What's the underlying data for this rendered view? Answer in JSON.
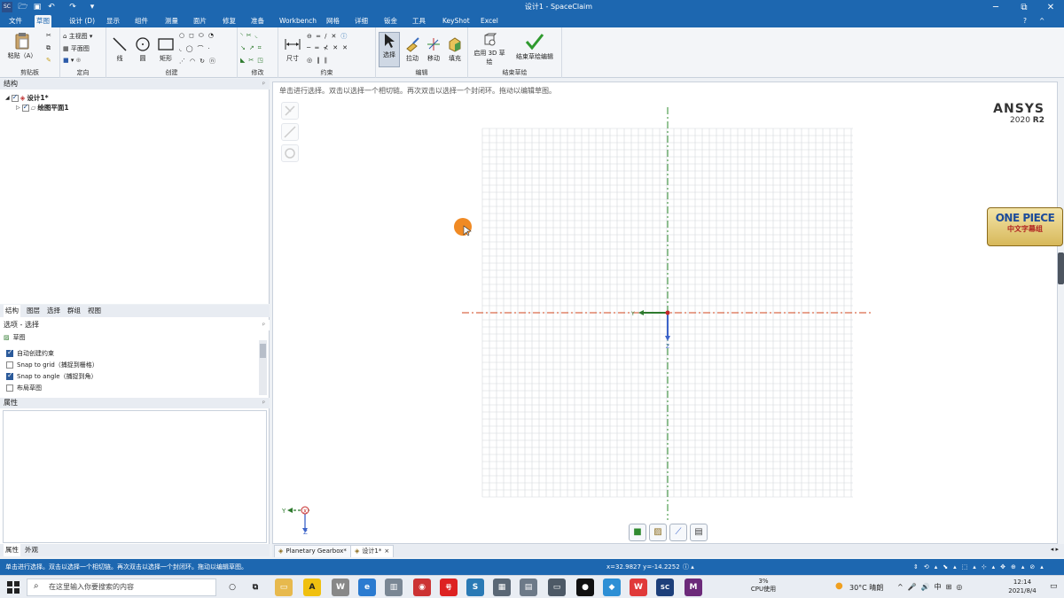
{
  "titlebar": {
    "title": "设计1 - SpaceClaim",
    "app_badge": "SC",
    "min": "─",
    "max": "⧉",
    "close": "✕"
  },
  "menu": {
    "tabs": [
      "文件",
      "草图",
      "设计 (D)",
      "显示",
      "组件",
      "测量",
      "面片",
      "修复",
      "准备",
      "Workbench",
      "网格",
      "详细",
      "钣金",
      "工具",
      "KeyShot",
      "Excel"
    ]
  },
  "ribbon": {
    "clipboard": {
      "paste": "粘贴（A）",
      "group": "剪贴板"
    },
    "orient": {
      "home": "主视图",
      "plane": "平面图",
      "group": "定向"
    },
    "create": {
      "line": "线",
      "circle": "圆",
      "rect": "矩形",
      "group": "创建"
    },
    "modify": {
      "group": "修改"
    },
    "constraint": {
      "dimension": "尺寸",
      "group": "约束"
    },
    "edit": {
      "select": "选择",
      "pull": "拉动",
      "move": "移动",
      "fill": "填充",
      "group": "编辑"
    },
    "finish": {
      "enable3d": "启用 3D 草绘",
      "finish": "结束草绘编辑",
      "group": "结束草绘"
    }
  },
  "structure": {
    "header": "结构",
    "root": "设计1*",
    "child": "绘图平面1"
  },
  "panel_tabs": [
    "结构",
    "图层",
    "选择",
    "群组",
    "视图"
  ],
  "options": {
    "header": "选项 - 选择",
    "section": "草图",
    "items": [
      {
        "label": "自动创建约束",
        "checked": true
      },
      {
        "label": "Snap to grid（捕捉到栅格）",
        "checked": false
      },
      {
        "label": "Snap to angle（捕捉到角）",
        "checked": true
      },
      {
        "label": "布局草图",
        "checked": false
      }
    ]
  },
  "properties": {
    "header": "属性"
  },
  "bottom_tabs": [
    "属性",
    "外观"
  ],
  "canvas": {
    "hint": "单击进行选择。双击以选择一个相切链。再次双击以选择一个封闭环。拖动以编辑草图。",
    "ansys": "ANSYS",
    "release_year": "2020",
    "release_tag": "R2",
    "badge_text": "ONE PIECE",
    "badge_sub": "中文字幕组",
    "axis_y": "Y",
    "axis_z": "Z",
    "axis_x": "X"
  },
  "docs": {
    "tabs": [
      {
        "label": "Planetary Gearbox*",
        "active": false
      },
      {
        "label": "设计1*",
        "active": true
      }
    ],
    "close": "×"
  },
  "status": {
    "text": "单击进行选择。双击以选择一个相切链。再次双击以选择一个封闭环。拖动以编辑草图。",
    "coords": "x=32.9827  y=-14.2252"
  },
  "taskbar": {
    "search_placeholder": "在这里输入你要搜索的内容",
    "cpu_percent": "3%",
    "cpu_label": "CPU使用",
    "weather": "30°C 晴朗",
    "time": "12:14",
    "date": "2021/8/4",
    "lang": "中"
  },
  "colors": {
    "accent": "#1d67b0",
    "axis_green": "#2e8b2e",
    "axis_red": "#d0441c",
    "grid": "#d4d7dc",
    "cursor": "#f08a24"
  }
}
